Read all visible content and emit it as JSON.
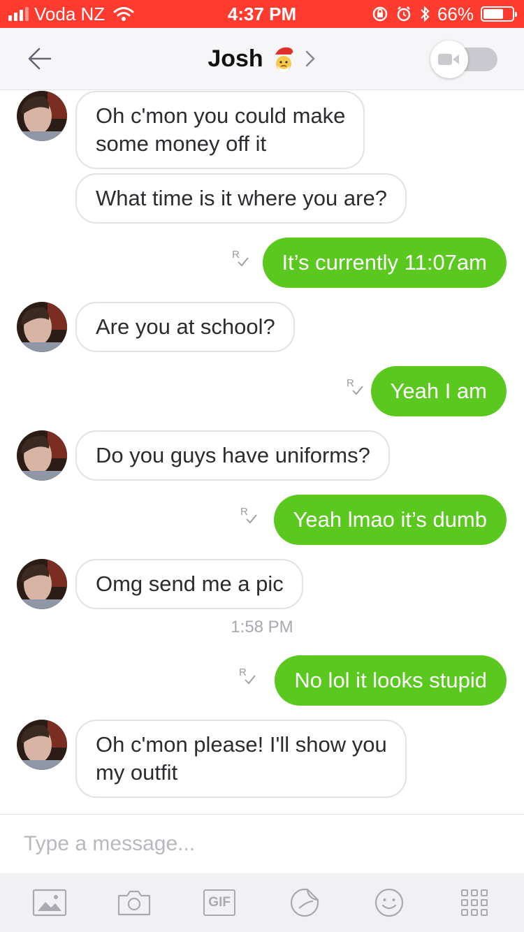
{
  "status_bar": {
    "carrier": "Voda NZ",
    "time": "4:37 PM",
    "battery_percent": "66%",
    "background": "#ff3b30"
  },
  "header": {
    "title": "Josh",
    "title_emoji_icon": "santa-icon",
    "back_icon": "arrow-left-icon",
    "video_toggle_icon": "video-camera-icon"
  },
  "messages": [
    {
      "direction": "incoming",
      "text_lines": [
        "Oh c'mon you could make",
        "some money off it"
      ],
      "show_avatar": true
    },
    {
      "direction": "incoming",
      "text": "What time is it where you are?",
      "show_avatar": false
    },
    {
      "direction": "outgoing",
      "text": "It’s currently 11:07am",
      "receipt": "R"
    },
    {
      "direction": "incoming",
      "text": "Are you at school?",
      "show_avatar": true
    },
    {
      "direction": "outgoing",
      "text": "Yeah I am",
      "receipt": "R"
    },
    {
      "direction": "incoming",
      "text": "Do you guys have uniforms?",
      "show_avatar": true
    },
    {
      "direction": "outgoing",
      "text": "Yeah lmao it’s dumb",
      "receipt": "R"
    },
    {
      "direction": "incoming",
      "text": "Omg send me a pic",
      "show_avatar": true
    },
    {
      "direction": "outgoing",
      "text": "No lol it looks stupid",
      "receipt": "R"
    },
    {
      "direction": "incoming",
      "text_lines": [
        "Oh c'mon please! I'll show you",
        "my outfit"
      ],
      "show_avatar": true
    }
  ],
  "timestamp": "1:58 PM",
  "composer": {
    "placeholder": "Type a message..."
  },
  "toolbar": {
    "items": [
      "image-icon",
      "camera-icon",
      "GIF",
      "sticker-icon",
      "smiley-icon",
      "grid-icon"
    ]
  },
  "colors": {
    "outgoing_bubble": "#5ac81e",
    "incoming_border": "#e2e2e6",
    "timestamp": "#a8a8ae"
  }
}
